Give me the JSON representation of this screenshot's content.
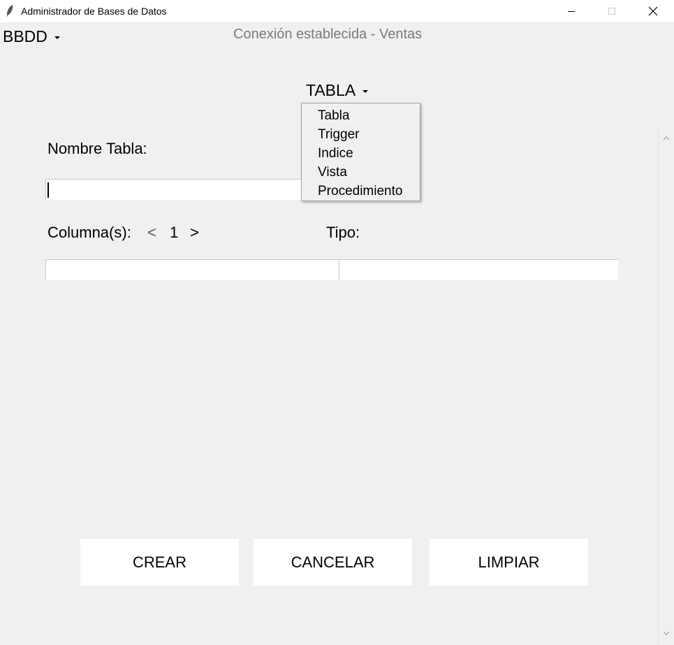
{
  "window": {
    "title": "Administrador de Bases de Datos"
  },
  "menus": {
    "bbdd": "BBDD",
    "tabla": "TABLA"
  },
  "status": "Conexión establecida - Ventas",
  "dropdown": {
    "items": [
      "Tabla",
      "Trigger",
      "Indice",
      "Vista",
      "Procedimiento"
    ]
  },
  "form": {
    "nombre_label": "Nombre Tabla:",
    "nombre_value": "",
    "columnas_label": "Columna(s):",
    "prev": "<",
    "column_index": "1",
    "next": ">",
    "tipo_label": "Tipo:",
    "columna_value": "",
    "tipo_value": ""
  },
  "buttons": {
    "crear": "CREAR",
    "cancelar": "CANCELAR",
    "limpiar": "LIMPIAR"
  },
  "icons": {
    "app": "feather-icon",
    "minimize": "minimize-icon",
    "maximize": "maximize-icon",
    "close": "close-icon",
    "dropdown": "caret-down-icon",
    "scroll_up": "chevron-up-icon",
    "scroll_down": "chevron-down-icon"
  }
}
